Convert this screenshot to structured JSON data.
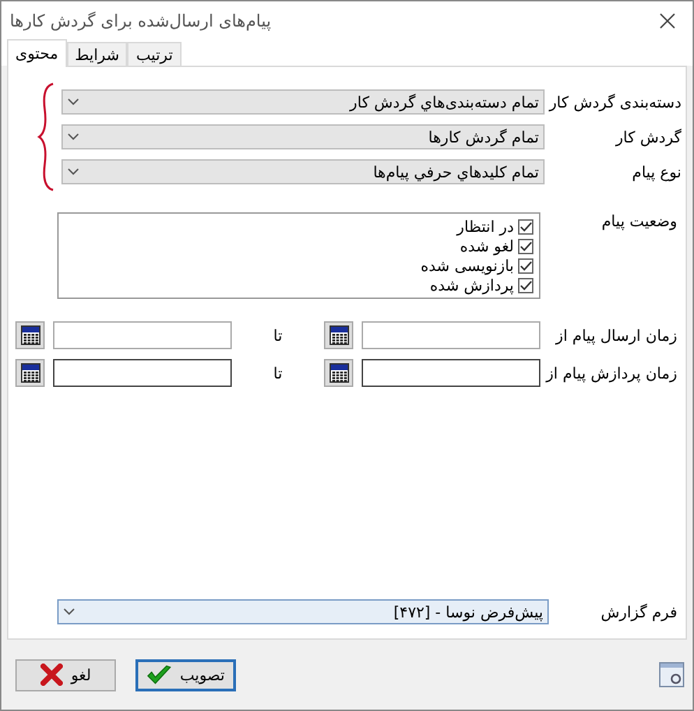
{
  "window": {
    "title": "پیام‌های ارسال‌شده برای گردش کارها"
  },
  "tabs": [
    {
      "label": "ترتیب",
      "selected": false
    },
    {
      "label": "شرایط",
      "selected": false
    },
    {
      "label": "محتوی",
      "selected": true
    }
  ],
  "filters": [
    {
      "label": "دسته‌بندی گردش کار",
      "value": "تمام دسته‌بندی‌هاي گردش کار"
    },
    {
      "label": "گردش کار",
      "value": "تمام گردش کارها"
    },
    {
      "label": "نوع پیام",
      "value": "تمام کلیدهاي حرفي پیام‌ها"
    }
  ],
  "status": {
    "label": "وضعیت پیام",
    "options": [
      {
        "label": "در انتظار",
        "checked": true
      },
      {
        "label": "لغو شده",
        "checked": true
      },
      {
        "label": "بازنویسی شده",
        "checked": true
      },
      {
        "label": "پردازش شده",
        "checked": true
      }
    ]
  },
  "date_ranges": [
    {
      "label": "زمان ارسال پیام از",
      "separator": "تا"
    },
    {
      "label": "زمان پردازش پیام از",
      "separator": "تا"
    }
  ],
  "report_form": {
    "label": "فرم گزارش",
    "value": "پیش‌فرض نوسا - [۴۷۲]"
  },
  "buttons": [
    {
      "label": "تصویب",
      "kind": "ok"
    },
    {
      "label": "لغو",
      "kind": "cancel"
    }
  ]
}
